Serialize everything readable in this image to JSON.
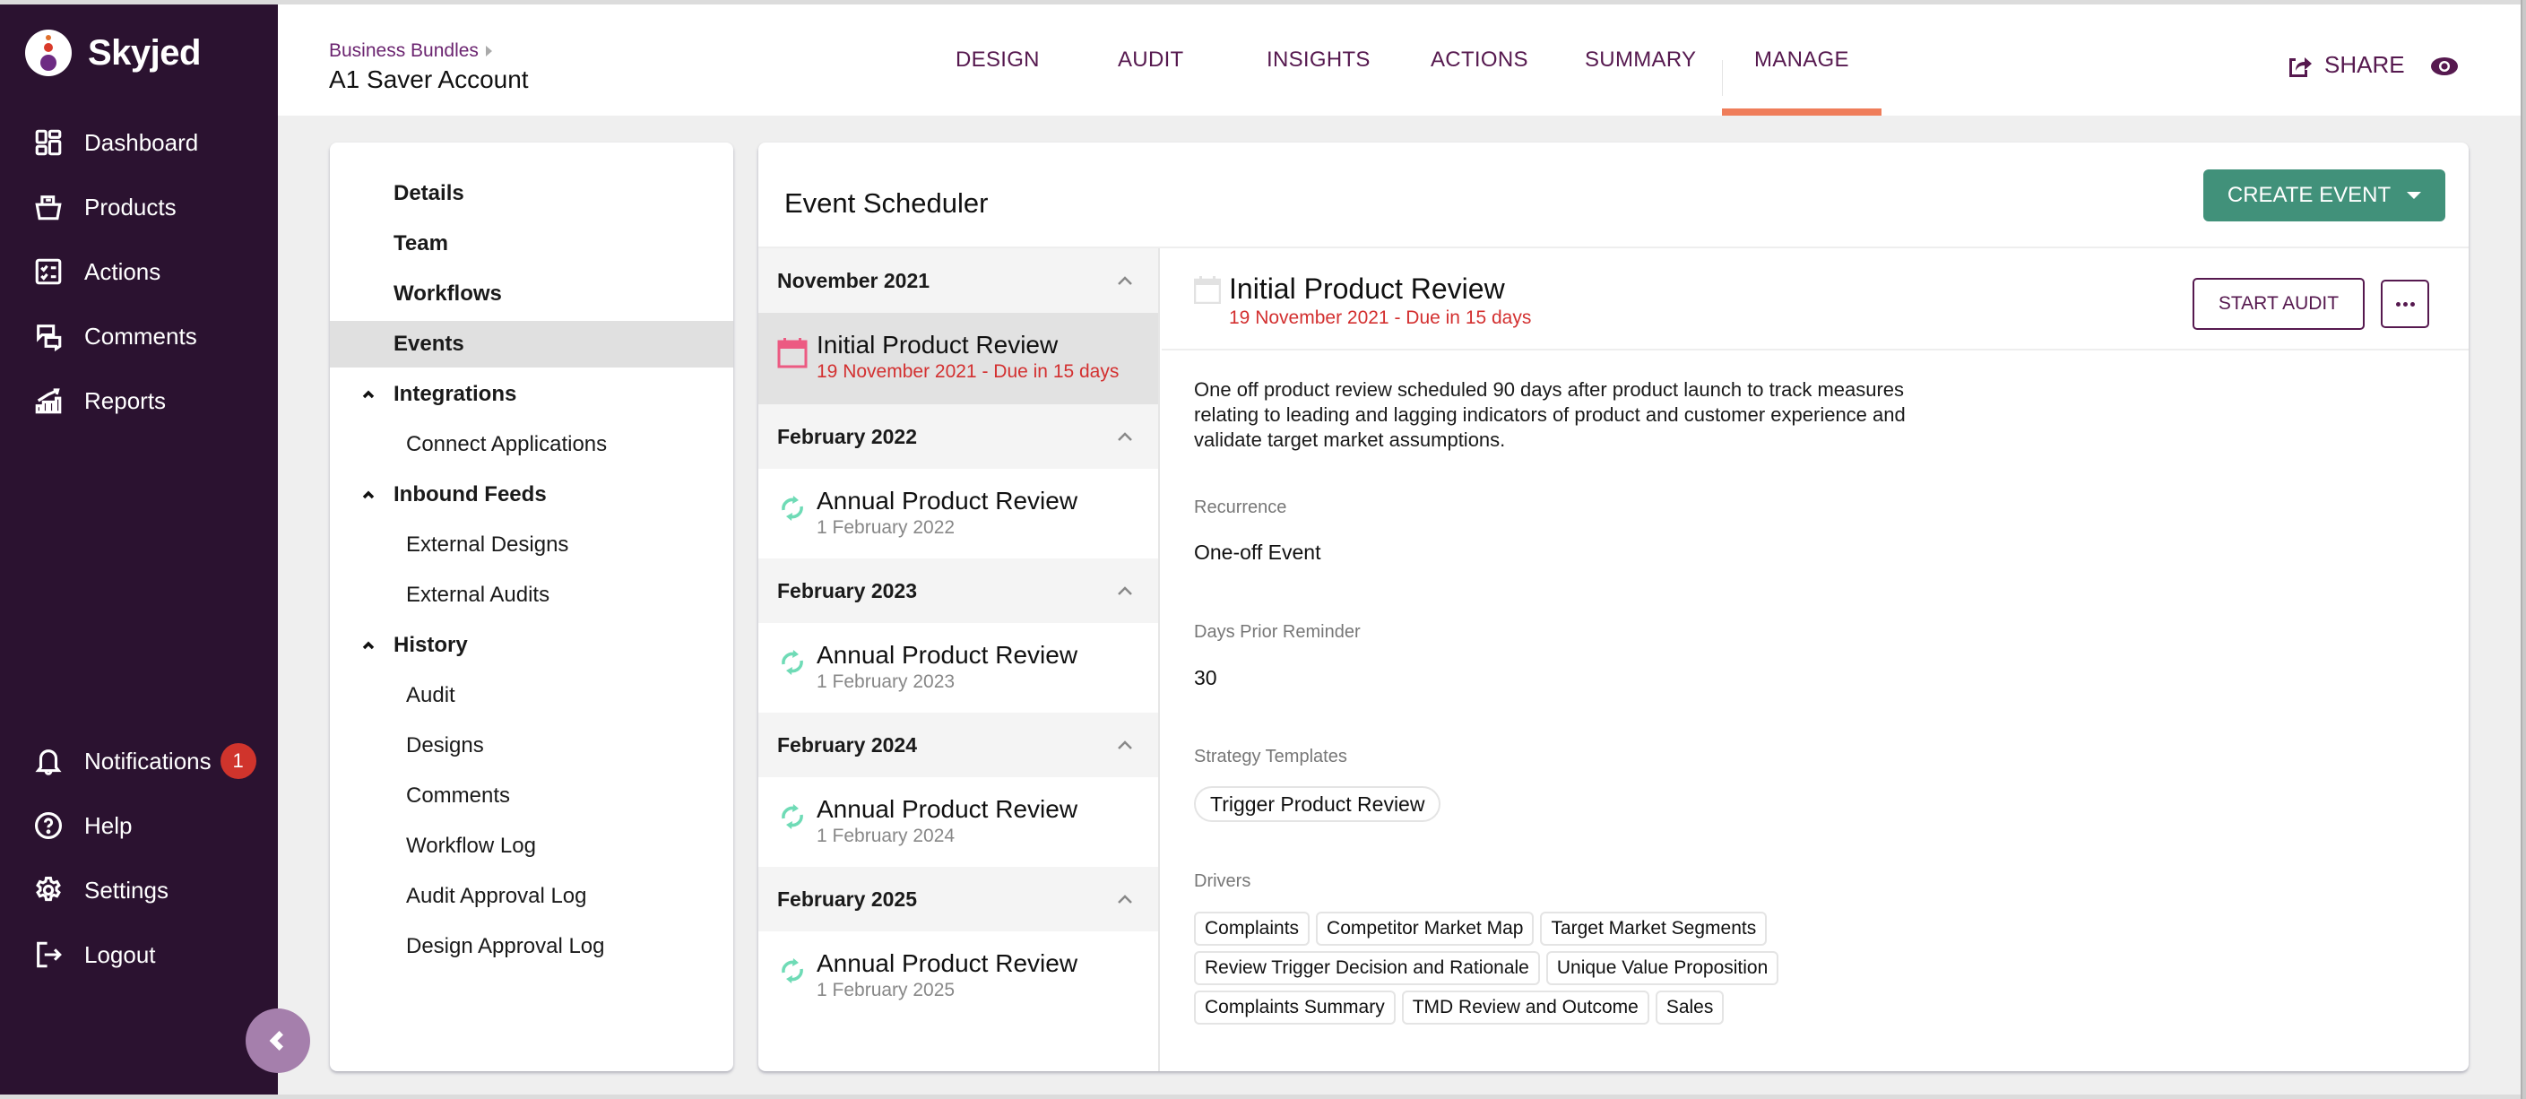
{
  "app": {
    "name": "Skyjed",
    "accent": "#56194f",
    "sidebar_bg": "#2b1230",
    "tab_indicator": "#ef7d5a",
    "primary_button": "#41917a",
    "due_color": "#d33030"
  },
  "sidebar": {
    "top_items": [
      {
        "label": "Dashboard",
        "icon": "dashboard-icon"
      },
      {
        "label": "Products",
        "icon": "products-icon"
      },
      {
        "label": "Actions",
        "icon": "actions-icon"
      },
      {
        "label": "Comments",
        "icon": "comments-icon"
      },
      {
        "label": "Reports",
        "icon": "reports-icon"
      }
    ],
    "bottom_items": [
      {
        "label": "Notifications",
        "icon": "bell-icon",
        "badge": "1"
      },
      {
        "label": "Help",
        "icon": "help-icon"
      },
      {
        "label": "Settings",
        "icon": "gear-icon"
      },
      {
        "label": "Logout",
        "icon": "logout-icon"
      }
    ],
    "collapse_icon": "chevron-left-icon"
  },
  "header": {
    "breadcrumb": "Business Bundles",
    "title": "A1 Saver Account",
    "tabs": [
      {
        "label": "DESIGN",
        "active": false
      },
      {
        "label": "AUDIT",
        "active": false
      },
      {
        "label": "INSIGHTS",
        "active": false
      },
      {
        "label": "ACTIONS",
        "active": false
      },
      {
        "label": "SUMMARY",
        "active": false
      },
      {
        "label": "MANAGE",
        "active": true
      }
    ],
    "share_label": "SHARE",
    "share_icon": "share-icon",
    "view_icon": "eye-icon"
  },
  "manage_nav": {
    "items": [
      {
        "label": "Details",
        "type": "top"
      },
      {
        "label": "Team",
        "type": "top"
      },
      {
        "label": "Workflows",
        "type": "top"
      },
      {
        "label": "Events",
        "type": "top",
        "selected": true
      },
      {
        "label": "Integrations",
        "type": "group",
        "expanded": true
      },
      {
        "label": "Connect Applications",
        "type": "sub"
      },
      {
        "label": "Inbound Feeds",
        "type": "group",
        "expanded": true
      },
      {
        "label": "External Designs",
        "type": "sub"
      },
      {
        "label": "External Audits",
        "type": "sub"
      },
      {
        "label": "History",
        "type": "group",
        "expanded": true
      },
      {
        "label": "Audit",
        "type": "sub"
      },
      {
        "label": "Designs",
        "type": "sub"
      },
      {
        "label": "Comments",
        "type": "sub"
      },
      {
        "label": "Workflow Log",
        "type": "sub"
      },
      {
        "label": "Audit Approval Log",
        "type": "sub"
      },
      {
        "label": "Design Approval Log",
        "type": "sub"
      }
    ]
  },
  "scheduler": {
    "title": "Event Scheduler",
    "create_button": "CREATE EVENT",
    "groups": [
      {
        "month": "November 2021",
        "events": [
          {
            "name": "Initial Product Review",
            "date": "19 November 2021 - Due in 15 days",
            "type": "one-off",
            "due": true,
            "selected": true
          }
        ]
      },
      {
        "month": "February 2022",
        "events": [
          {
            "name": "Annual Product Review",
            "date": "1 February 2022",
            "type": "recurring"
          }
        ]
      },
      {
        "month": "February 2023",
        "events": [
          {
            "name": "Annual Product Review",
            "date": "1 February 2023",
            "type": "recurring"
          }
        ]
      },
      {
        "month": "February 2024",
        "events": [
          {
            "name": "Annual Product Review",
            "date": "1 February 2024",
            "type": "recurring"
          }
        ]
      },
      {
        "month": "February 2025",
        "events": [
          {
            "name": "Annual Product Review",
            "date": "1 February 2025",
            "type": "recurring"
          }
        ]
      }
    ]
  },
  "detail": {
    "title": "Initial Product Review",
    "date": "19 November 2021 - Due in 15 days",
    "start_audit_label": "START AUDIT",
    "more_icon": "more-horizontal-icon",
    "description": "One off product review scheduled 90 days after product launch to track measures relating to leading and lagging indicators of product and customer experience and validate target market assumptions.",
    "recurrence_label": "Recurrence",
    "recurrence_value": "One-off Event",
    "reminder_label": "Days Prior Reminder",
    "reminder_value": "30",
    "templates_label": "Strategy Templates",
    "templates": [
      "Trigger Product Review"
    ],
    "drivers_label": "Drivers",
    "drivers": [
      "Complaints",
      "Competitor Market Map",
      "Target Market Segments",
      "Review Trigger Decision and Rationale",
      "Unique Value Proposition",
      "Complaints Summary",
      "TMD Review and Outcome",
      "Sales"
    ]
  }
}
